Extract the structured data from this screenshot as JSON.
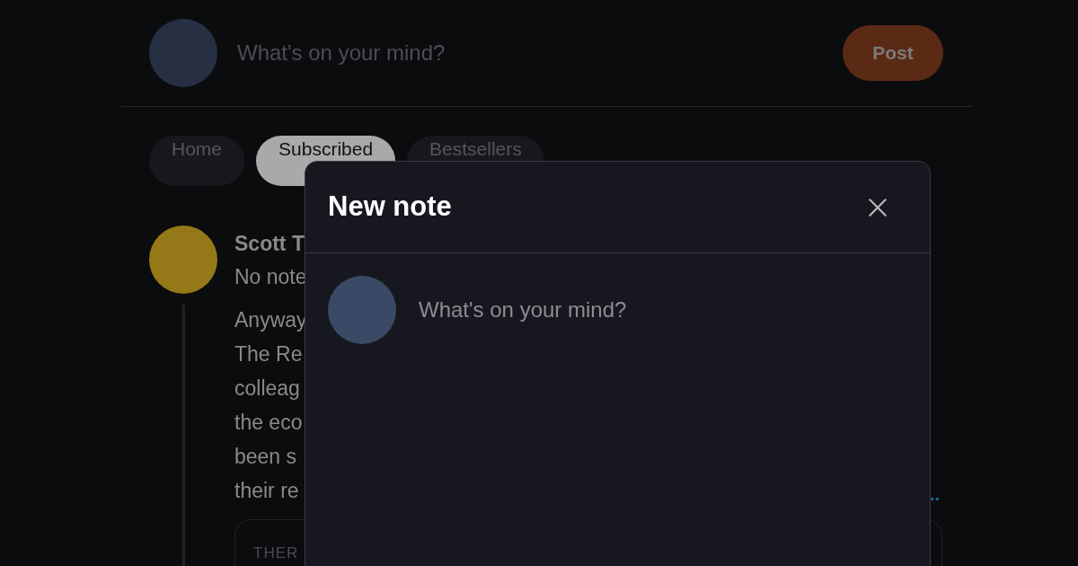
{
  "composer": {
    "placeholder": "What's on your mind?",
    "post_button": "Post"
  },
  "tabs": [
    {
      "label": "Home",
      "selected": false
    },
    {
      "label": "Subscribed",
      "selected": true
    },
    {
      "label": "Bestsellers",
      "selected": false
    }
  ],
  "feed": {
    "author": "Scott T",
    "subtitle": "No note",
    "body_lines": [
      "Anyway",
      "The Re",
      "colleag",
      "the eco",
      "been s",
      "their re"
    ],
    "more": "..",
    "card_label": "THER"
  },
  "modal": {
    "title": "New note",
    "placeholder": "What's on your mind?"
  }
}
